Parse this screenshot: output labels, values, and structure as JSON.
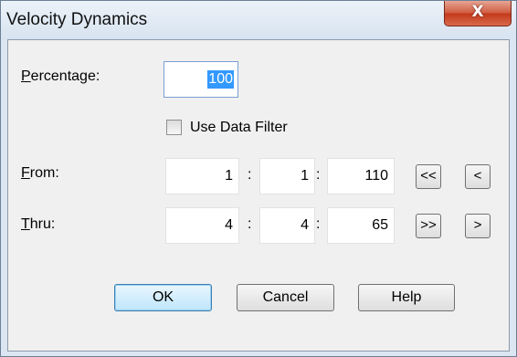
{
  "window": {
    "title": "Velocity Dynamics",
    "close_glyph": "X"
  },
  "percentage": {
    "label_first": "P",
    "label_rest": "ercentage:",
    "value": "100"
  },
  "data_filter": {
    "label": "Use Data Filter",
    "checked": false
  },
  "from": {
    "label_first": "F",
    "label_rest": "rom:",
    "bar": "1",
    "beat": "1",
    "tick": "110",
    "first_btn": "<<",
    "prev_btn": "<"
  },
  "thru": {
    "label_first": "T",
    "label_rest": "hru:",
    "bar": "4",
    "beat": "4",
    "tick": "65",
    "last_btn": ">>",
    "next_btn": ">"
  },
  "separator": ":",
  "buttons": {
    "ok": "OK",
    "cancel": "Cancel",
    "help": "Help"
  },
  "colors": {
    "selection": "#3399ff",
    "close": "#c4381a"
  }
}
